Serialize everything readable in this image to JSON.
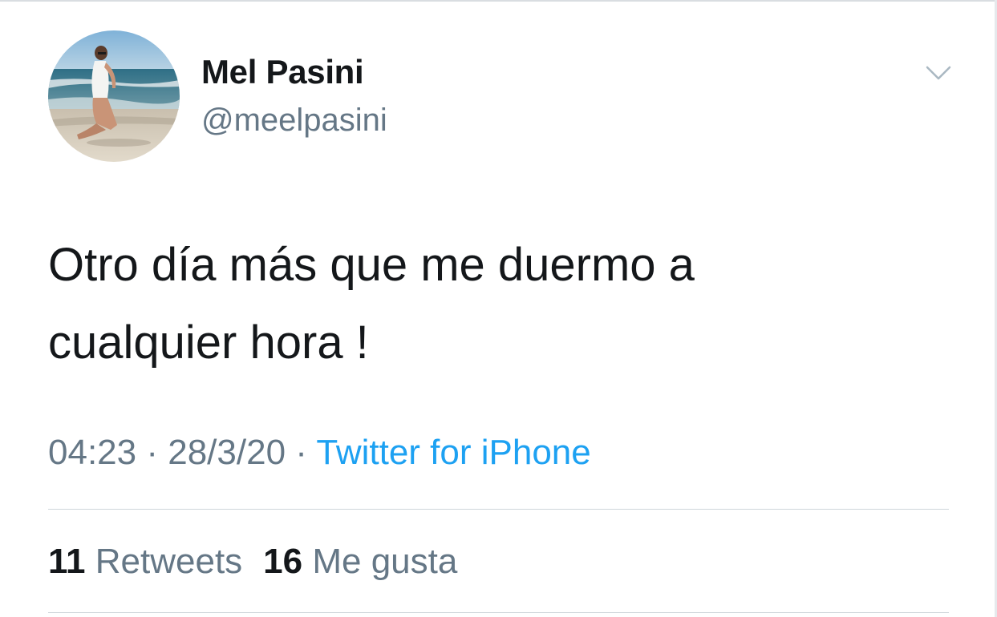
{
  "tweet": {
    "author": {
      "display_name": "Mel Pasini",
      "handle": "@meelpasini"
    },
    "text_lines": [
      "Otro día más que me duermo a",
      "cualquier hora !"
    ],
    "time": "04:23",
    "separator": "·",
    "date": "28/3/20",
    "source": "Twitter for iPhone",
    "stats": {
      "retweets_count": "11",
      "retweets_label": "Retweets",
      "likes_count": "16",
      "likes_label": "Me gusta"
    }
  },
  "colors": {
    "text_primary": "#14171a",
    "text_secondary": "#657786",
    "link": "#1da1f2",
    "divider": "#cfd6db"
  },
  "icons": {
    "menu": "chevron-down-icon"
  }
}
